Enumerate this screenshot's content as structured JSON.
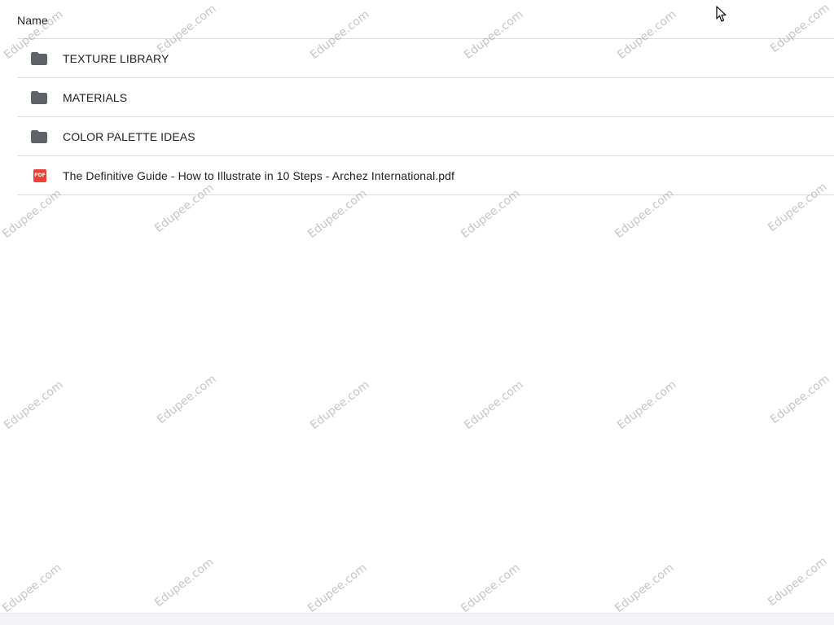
{
  "list": {
    "header_label": "Name",
    "rows": [
      {
        "type": "folder",
        "icon": "folder-icon",
        "name": "TEXTURE LIBRARY"
      },
      {
        "type": "folder",
        "icon": "folder-icon",
        "name": "MATERIALS"
      },
      {
        "type": "folder",
        "icon": "folder-icon",
        "name": "COLOR PALETTE IDEAS"
      },
      {
        "type": "pdf",
        "icon": "pdf-file-icon",
        "icon_text": "PDF",
        "name": "The Definitive Guide - How to Illustrate in 10 Steps - Archez International.pdf"
      }
    ]
  },
  "watermark": {
    "text": "Edupee.com"
  },
  "colors": {
    "folder": "#5f6368",
    "pdf": "#ea4335",
    "divider": "#dadce0",
    "text": "#202124"
  }
}
